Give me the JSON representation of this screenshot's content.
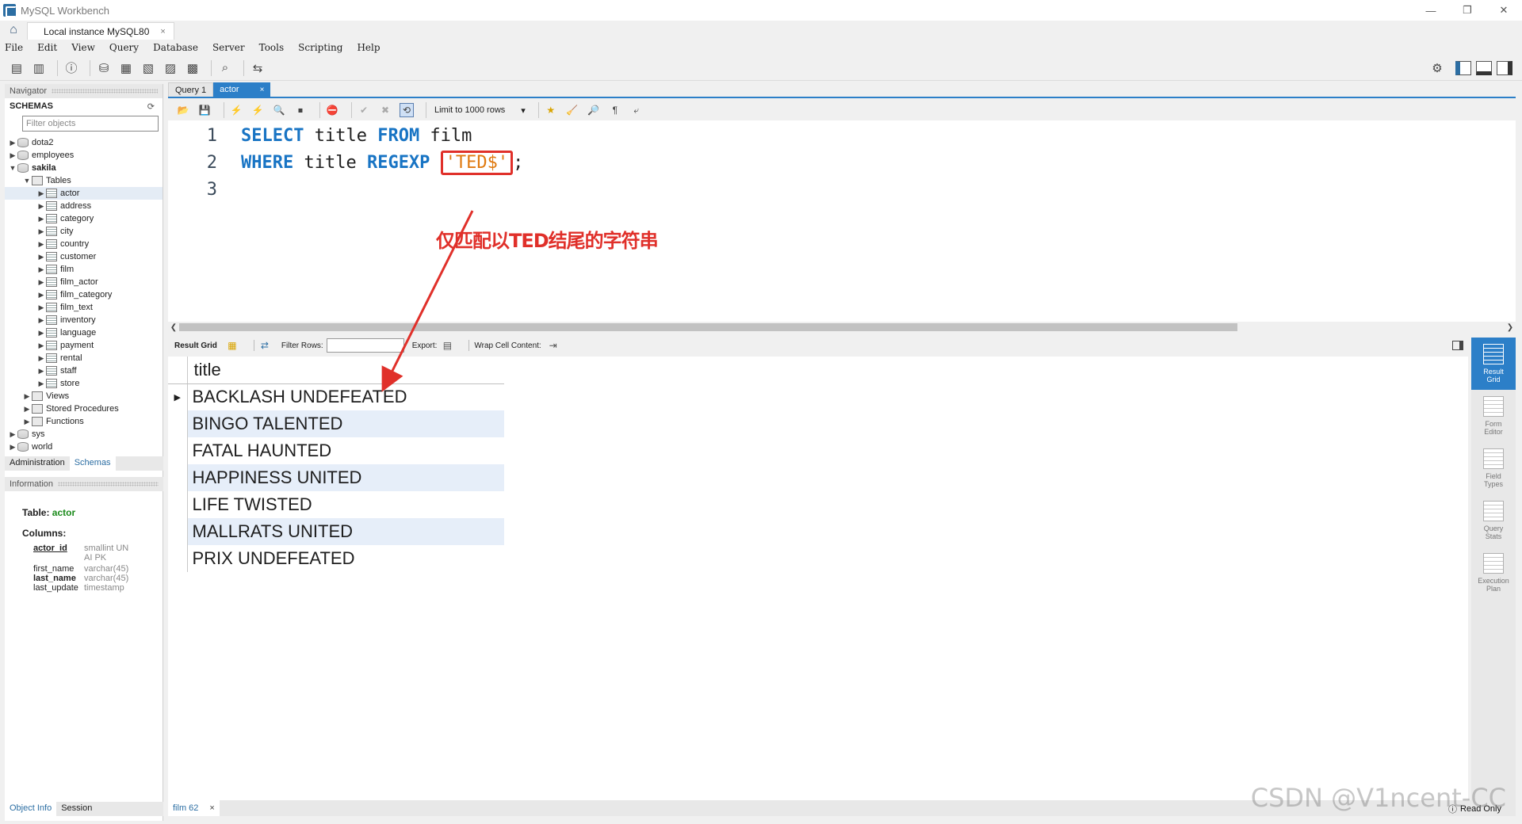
{
  "window": {
    "title": "MySQL Workbench",
    "controls": [
      "—",
      "❐",
      "✕"
    ]
  },
  "connection_tab": {
    "label": "Local instance MySQL80",
    "close": "×"
  },
  "menu": [
    "File",
    "Edit",
    "View",
    "Query",
    "Database",
    "Server",
    "Tools",
    "Scripting",
    "Help"
  ],
  "navigator": {
    "header": "Navigator",
    "schemas_title": "SCHEMAS",
    "filter_placeholder": "Filter objects",
    "schemas": [
      "dota2",
      "employees",
      "sakila"
    ],
    "sakila_children": {
      "tables_label": "Tables",
      "tables": [
        "actor",
        "address",
        "category",
        "city",
        "country",
        "customer",
        "film",
        "film_actor",
        "film_category",
        "film_text",
        "inventory",
        "language",
        "payment",
        "rental",
        "staff",
        "store"
      ],
      "views": "Views",
      "procedures": "Stored Procedures",
      "functions": "Functions"
    },
    "after_schemas": [
      "sys",
      "world"
    ],
    "tabs": {
      "admin": "Administration",
      "schemas": "Schemas"
    }
  },
  "information": {
    "header": "Information",
    "table_label": "Table:",
    "table_name": "actor",
    "columns_label": "Columns:",
    "columns": [
      {
        "name": "actor_id",
        "type": "smallint UN",
        "type2": "AI PK"
      },
      {
        "name": "first_name",
        "type": "varchar(45)"
      },
      {
        "name": "last_name",
        "type": "varchar(45)"
      },
      {
        "name": "last_update",
        "type": "timestamp"
      }
    ],
    "bottom_tabs": {
      "object_info": "Object Info",
      "session": "Session"
    }
  },
  "query_tabs": [
    {
      "label": "Query 1"
    },
    {
      "label": "actor",
      "close": "×"
    }
  ],
  "sql_toolbar": {
    "limit": "Limit to 1000 rows"
  },
  "editor": {
    "lines": [
      {
        "num": "1",
        "kw1": "SELECT",
        "t1": " title ",
        "kw2": "FROM",
        "t2": " film"
      },
      {
        "num": "2",
        "kw1": "WHERE",
        "t1": " title ",
        "kw2": "REGEXP",
        "str": "'TED$'",
        "t2": ";"
      },
      {
        "num": "3"
      }
    ],
    "annotation": "仅匹配以TED结尾的字符串"
  },
  "result_toolbar": {
    "result_grid": "Result Grid",
    "filter_rows": "Filter Rows:",
    "export": "Export:",
    "wrap": "Wrap Cell Content:"
  },
  "result": {
    "column": "title",
    "rows": [
      "BACKLASH UNDEFEATED",
      "BINGO TALENTED",
      "FATAL HAUNTED",
      "HAPPINESS UNITED",
      "LIFE TWISTED",
      "MALLRATS UNITED",
      "PRIX UNDEFEATED"
    ]
  },
  "right_panel": [
    {
      "label1": "Result",
      "label2": "Grid"
    },
    {
      "label1": "Form",
      "label2": "Editor"
    },
    {
      "label1": "Field",
      "label2": "Types"
    },
    {
      "label1": "Query",
      "label2": "Stats"
    },
    {
      "label1": "Execution",
      "label2": "Plan"
    }
  ],
  "bottom_bar": {
    "output_tab": "film 62",
    "close": "×",
    "status": "Read Only"
  },
  "watermark": "CSDN @V1ncent-CC"
}
